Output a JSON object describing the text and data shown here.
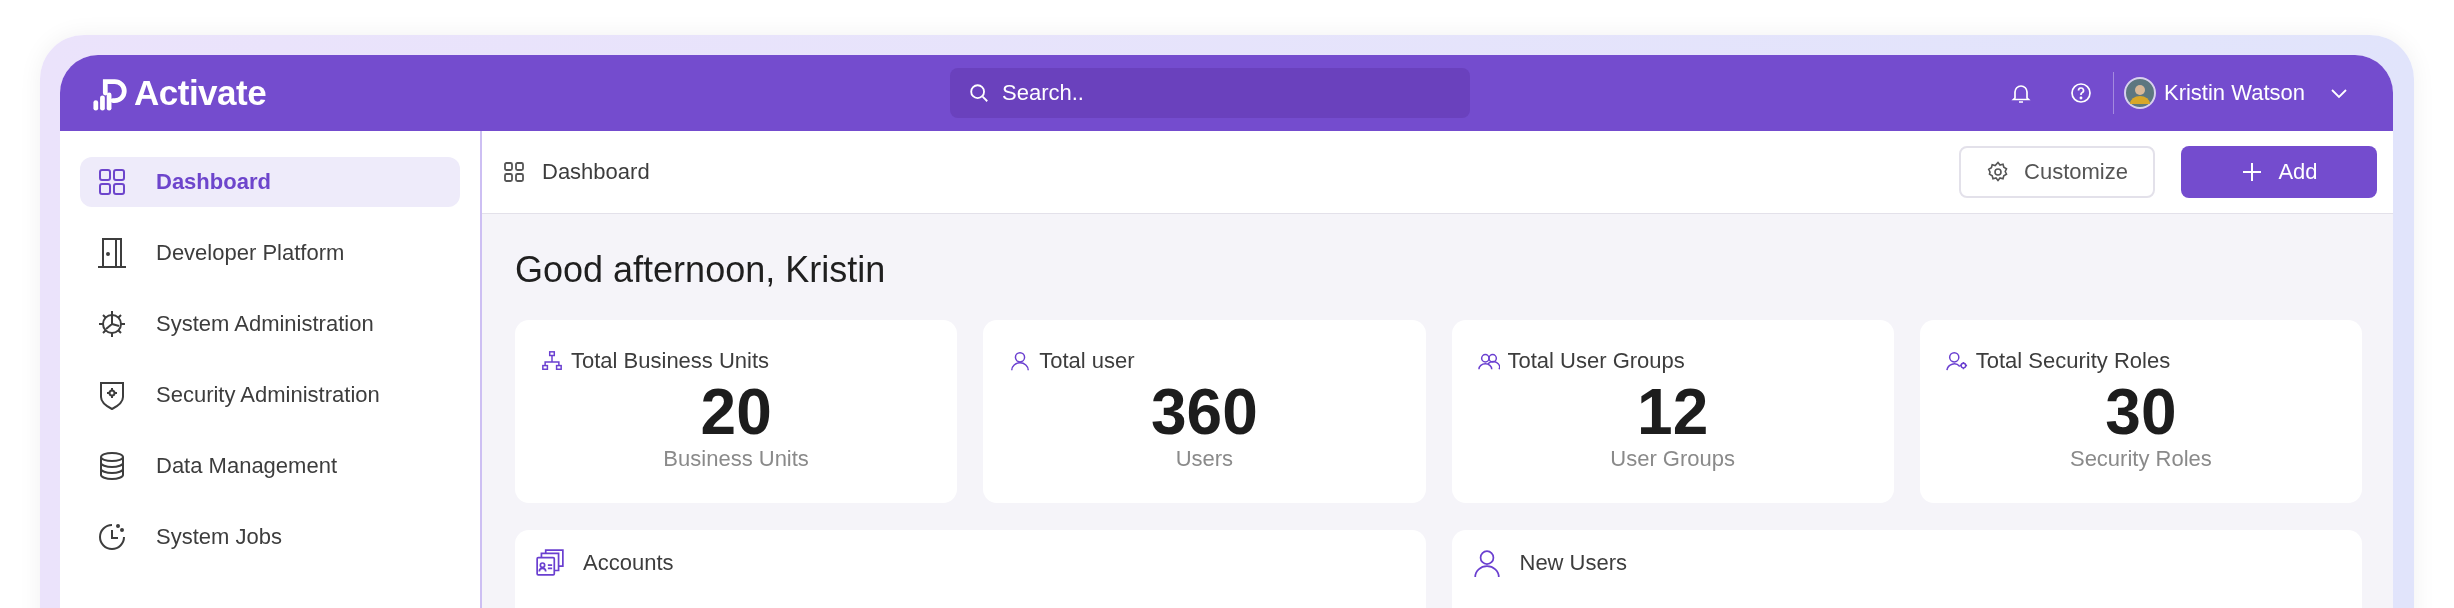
{
  "app": {
    "logo": "Activate"
  },
  "search": {
    "placeholder": "Search.."
  },
  "user": {
    "name": "Kristin Watson"
  },
  "sidebar": {
    "items": [
      {
        "label": "Dashboard",
        "kind": "grid",
        "selected": true
      },
      {
        "label": "Developer Platform",
        "kind": "door",
        "selected": false
      },
      {
        "label": "System Administration",
        "kind": "cog",
        "selected": false
      },
      {
        "label": "Security Administration",
        "kind": "shield",
        "selected": false
      },
      {
        "label": "Data Management",
        "kind": "database",
        "selected": false
      },
      {
        "label": "System Jobs",
        "kind": "clock",
        "selected": false
      }
    ]
  },
  "breadcrumb": "Dashboard",
  "toolbar": {
    "buttons": [
      {
        "label": "Customize",
        "kind": "secondary"
      },
      {
        "label": "Add",
        "kind": "primary"
      }
    ]
  },
  "greeting": "Good afternoon, Kristin",
  "stats": [
    {
      "title": "Total Business Units",
      "value": "20",
      "caption": "Business Units",
      "kind": "hierarchy"
    },
    {
      "title": "Total user",
      "value": "360",
      "caption": "Users",
      "kind": "user"
    },
    {
      "title": "Total User Groups",
      "value": "12",
      "caption": "User Groups",
      "kind": "users"
    },
    {
      "title": "Total Security Roles",
      "value": "30",
      "caption": "Security Roles",
      "kind": "roles"
    }
  ],
  "panels": [
    {
      "title": "Accounts",
      "kind": "accounts"
    },
    {
      "title": "New Users",
      "kind": "users"
    }
  ]
}
